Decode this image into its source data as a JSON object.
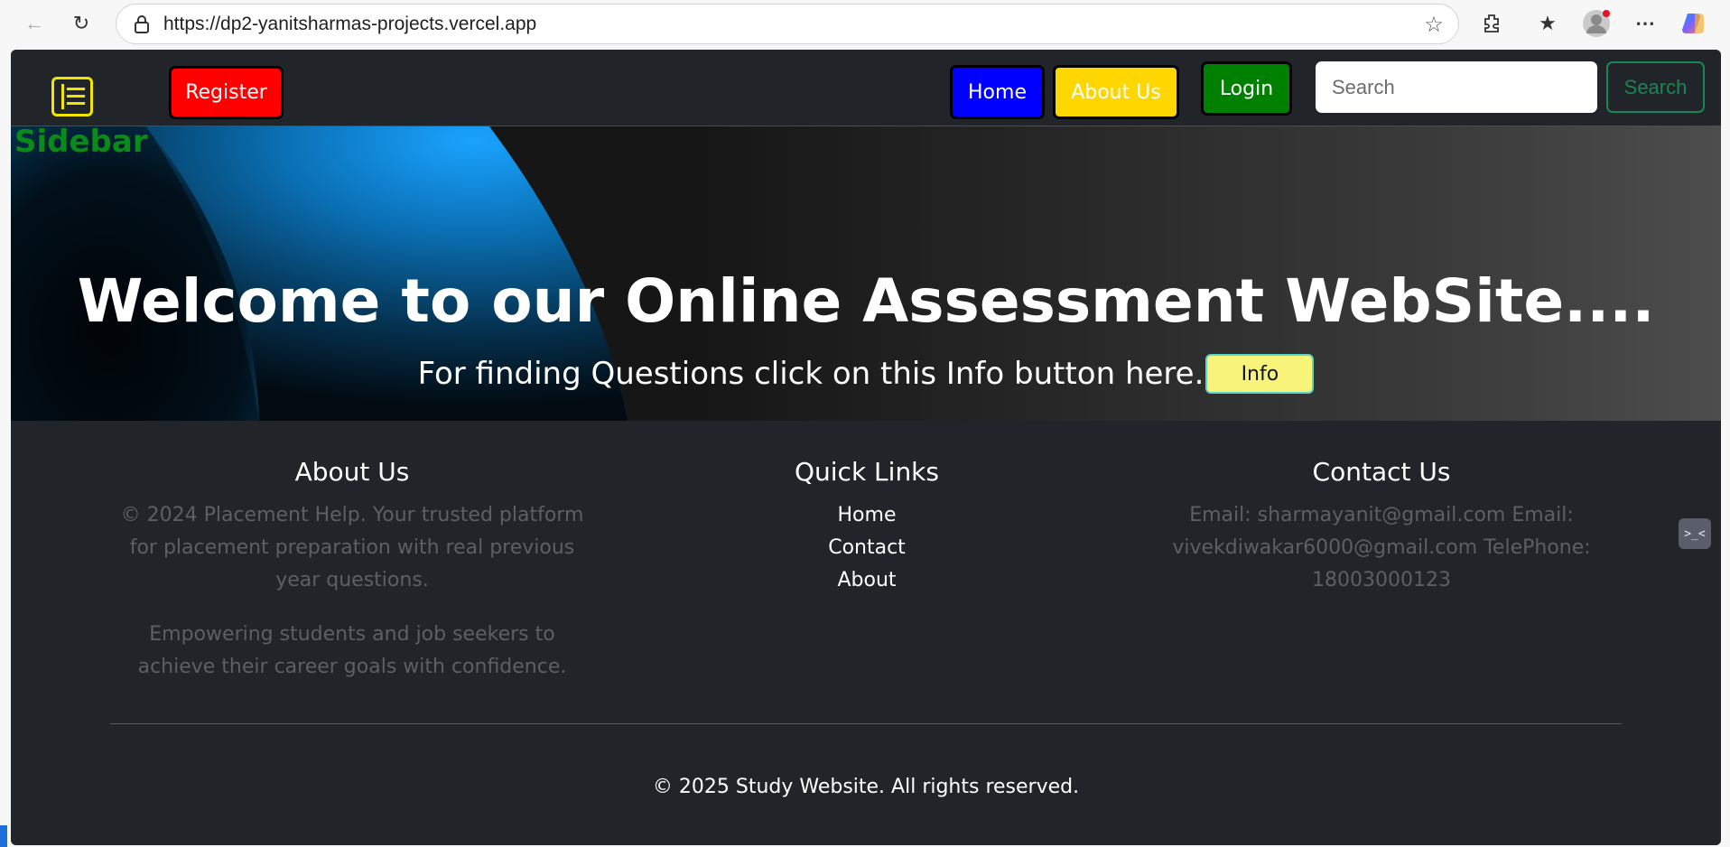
{
  "browser": {
    "url": "https://dp2-yanitsharmas-projects.vercel.app"
  },
  "navbar": {
    "register_label": "Register",
    "home_label": "Home",
    "about_label": "About Us",
    "login_label": "Login",
    "search_placeholder": "Search",
    "search_button_label": "Search"
  },
  "sidebar": {
    "label": "Sidebar"
  },
  "hero": {
    "title": "Welcome to our Online Assessment WebSite....",
    "subtitle": "For finding Questions click on this Info button here.",
    "info_label": "Info"
  },
  "footer": {
    "about": {
      "heading": "About Us",
      "paragraph1": "© 2024 Placement Help. Your trusted platform for placement preparation with real previous year questions.",
      "paragraph2": "Empowering students and job seekers to achieve their career goals with confidence."
    },
    "links": {
      "heading": "Quick Links",
      "items": [
        "Home",
        "Contact",
        "About"
      ]
    },
    "contact": {
      "heading": "Contact Us",
      "text": "Email: sharmayanit@gmail.com Email: vivekdiwakar6000@gmail.com TelePhone: 18003000123"
    },
    "copyright": "© 2025 Study Website. All rights reserved."
  },
  "colors": {
    "page_bg": "#212529",
    "register": "#ff0000",
    "home": "#0000ff",
    "about": "#ffd700",
    "login": "#008000",
    "search_outline": "#198754",
    "sidebar_label": "#0a8a1a",
    "menu_toggle": "#f2e600",
    "info_button": "#f8f47a"
  }
}
